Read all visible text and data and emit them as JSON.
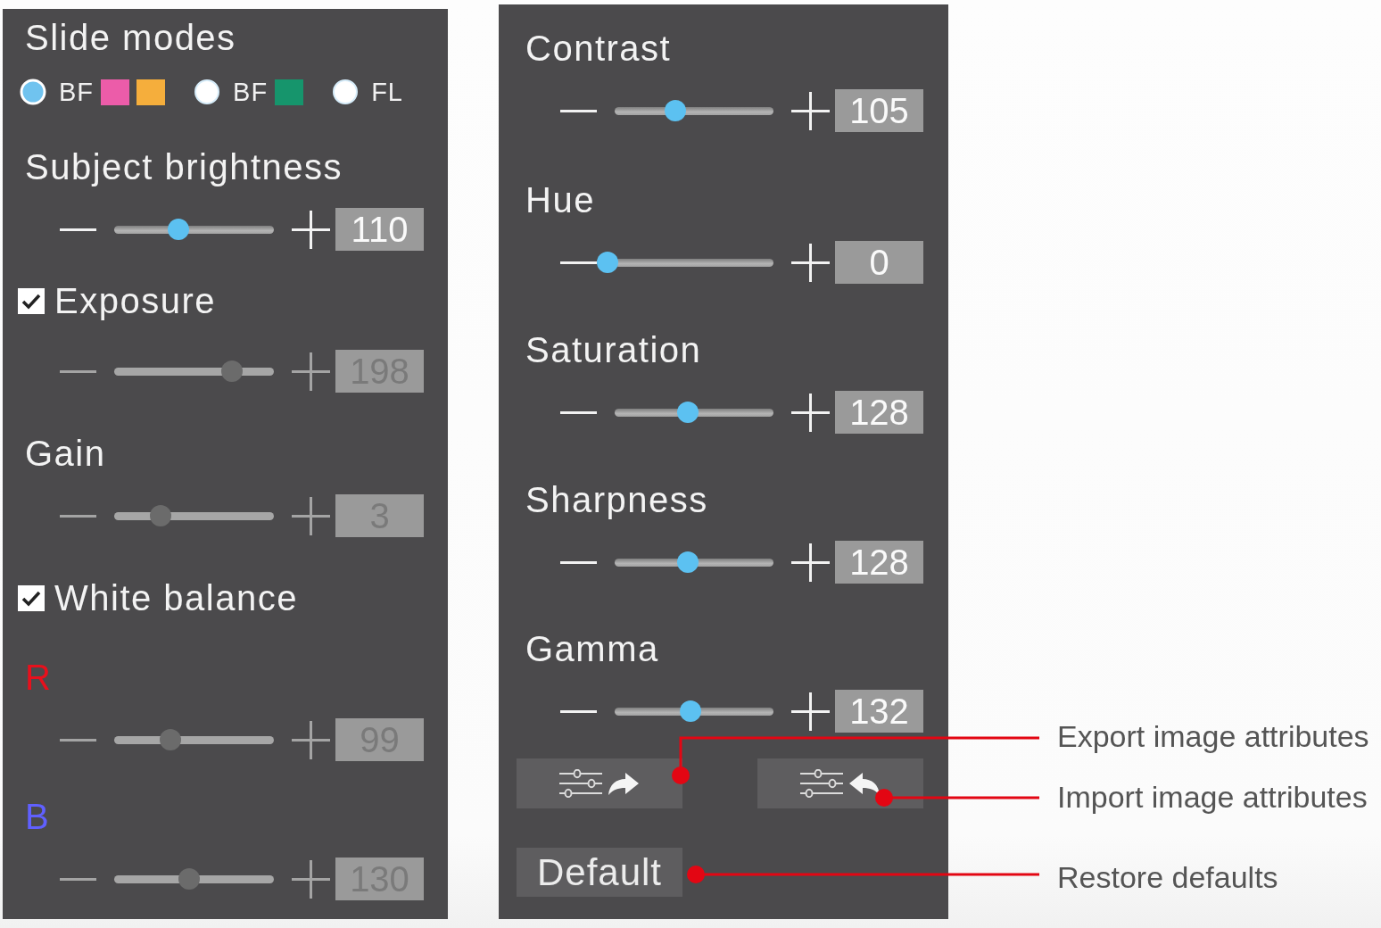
{
  "settings_panel": {
    "title": "Slide modes",
    "modes": [
      {
        "label": "BF",
        "selected": true,
        "swatches": [
          {
            "color": "#ec5ca9"
          },
          {
            "color": "#f5ae3c"
          }
        ]
      },
      {
        "label": "BF",
        "selected": false,
        "swatches": [
          {
            "color": "#16956c"
          }
        ]
      },
      {
        "label": "FL",
        "selected": false
      }
    ],
    "controls": [
      {
        "kind": "plain",
        "label": "Subject brightness",
        "slider": {
          "level": 0.4,
          "value": "110",
          "disabled": false
        }
      },
      {
        "kind": "checkbox",
        "label": "Exposure",
        "checked": true,
        "slider": {
          "level": 0.74,
          "value": "198",
          "disabled": true
        }
      },
      {
        "kind": "plain",
        "label": "Gain",
        "slider": {
          "level": 0.29,
          "value": "3",
          "disabled": true
        }
      },
      {
        "kind": "checkbox",
        "label": "White balance",
        "checked": true
      },
      {
        "kind": "channel",
        "label": "R",
        "color": "#e8101c",
        "slider": {
          "level": 0.35,
          "value": "99",
          "disabled": true
        }
      },
      {
        "kind": "channel",
        "label": "B",
        "color": "#6060ff",
        "slider": {
          "level": 0.47,
          "value": "130",
          "disabled": true
        }
      }
    ]
  },
  "image_panel": {
    "controls": [
      {
        "kind": "plain",
        "label": "Contrast",
        "slider": {
          "level": 0.38,
          "value": "105",
          "disabled": false
        }
      },
      {
        "kind": "plain",
        "label": "Hue",
        "slider": {
          "level": 0,
          "value": "0",
          "disabled": false
        }
      },
      {
        "kind": "plain",
        "label": "Saturation",
        "slider": {
          "level": 0.46,
          "value": "128",
          "disabled": false
        }
      },
      {
        "kind": "plain",
        "label": "Sharpness",
        "slider": {
          "level": 0.46,
          "value": "128",
          "disabled": false
        }
      },
      {
        "kind": "plain",
        "label": "Gamma",
        "slider": {
          "level": 0.48,
          "value": "132",
          "disabled": false
        }
      }
    ],
    "attribute_buttons": [
      {
        "kind": "export"
      },
      {
        "kind": "import"
      }
    ],
    "default_button": {
      "label": "Default"
    }
  },
  "annotations": [
    {
      "label": "Export image attributes"
    },
    {
      "label": "Import image attributes"
    },
    {
      "label": "Restore defaults"
    }
  ]
}
